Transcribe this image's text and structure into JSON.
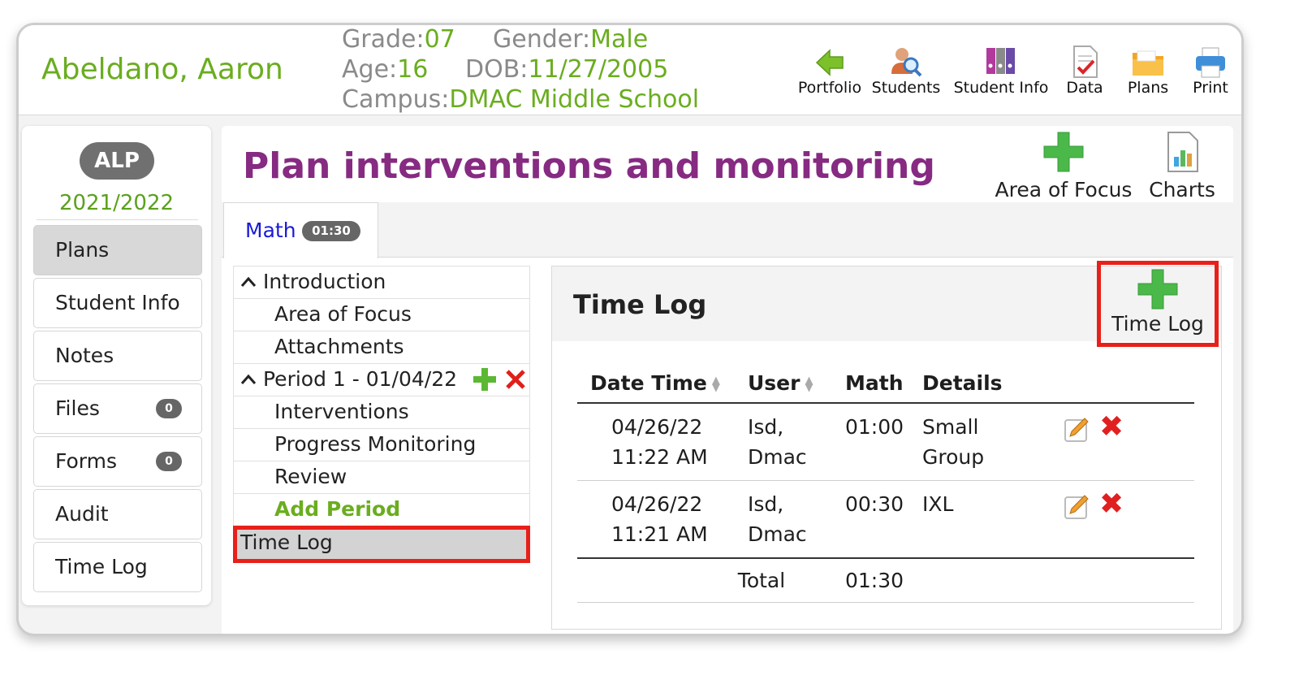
{
  "student": {
    "name": "Abeldano, Aaron",
    "grade_label": "Grade:",
    "grade": "07",
    "gender_label": "Gender:",
    "gender": "Male",
    "age_label": "Age:",
    "age": "16",
    "dob_label": "DOB:",
    "dob": "11/27/2005",
    "campus_label": "Campus:",
    "campus": "DMAC Middle School"
  },
  "top_nav": [
    {
      "label": "Portfolio",
      "icon": "green-back-arrow-icon"
    },
    {
      "label": "Students",
      "icon": "student-search-icon"
    },
    {
      "label": "Student Info",
      "icon": "binders-icon"
    },
    {
      "label": "Data",
      "icon": "document-check-icon"
    },
    {
      "label": "Plans",
      "icon": "folder-icon"
    },
    {
      "label": "Print",
      "icon": "printer-icon"
    }
  ],
  "sidebar": {
    "badge": "ALP",
    "year": "2021/2022",
    "items": [
      {
        "label": "Plans",
        "count": ""
      },
      {
        "label": "Student Info",
        "count": ""
      },
      {
        "label": "Notes",
        "count": ""
      },
      {
        "label": "Files",
        "count": "0"
      },
      {
        "label": "Forms",
        "count": "0"
      },
      {
        "label": "Audit",
        "count": ""
      },
      {
        "label": "Time Log",
        "count": ""
      }
    ]
  },
  "main": {
    "title": "Plan interventions and monitoring",
    "actions": [
      {
        "label": "Area of Focus",
        "icon": "green-plus-icon"
      },
      {
        "label": "Charts",
        "icon": "chart-icon"
      }
    ],
    "tab": {
      "label": "Math",
      "badge": "01:30"
    }
  },
  "tree": {
    "introduction": "Introduction",
    "area_of_focus": "Area of Focus",
    "attachments": "Attachments",
    "period": "Period 1 - 01/04/22",
    "interventions": "Interventions",
    "progress_monitoring": "Progress Monitoring",
    "review": "Review",
    "add_period": "Add Period",
    "time_log": "Time Log"
  },
  "time_log": {
    "title": "Time Log",
    "add_label": "Time Log",
    "columns": [
      "Date Time",
      "User",
      "Math",
      "Details"
    ],
    "rows": [
      {
        "date": "04/26/22",
        "time": "11:22 AM",
        "user1": "Isd,",
        "user2": "Dmac",
        "math": "01:00",
        "details1": "Small",
        "details2": "Group"
      },
      {
        "date": "04/26/22",
        "time": "11:21 AM",
        "user1": "Isd,",
        "user2": "Dmac",
        "math": "00:30",
        "details1": "IXL",
        "details2": ""
      }
    ],
    "total_label": "Total",
    "total_value": "01:30"
  },
  "colors": {
    "accent_green": "#6aad1f",
    "title_purple": "#862a82",
    "highlight_red": "#e8201a",
    "tab_blue": "#1a1ad8"
  }
}
